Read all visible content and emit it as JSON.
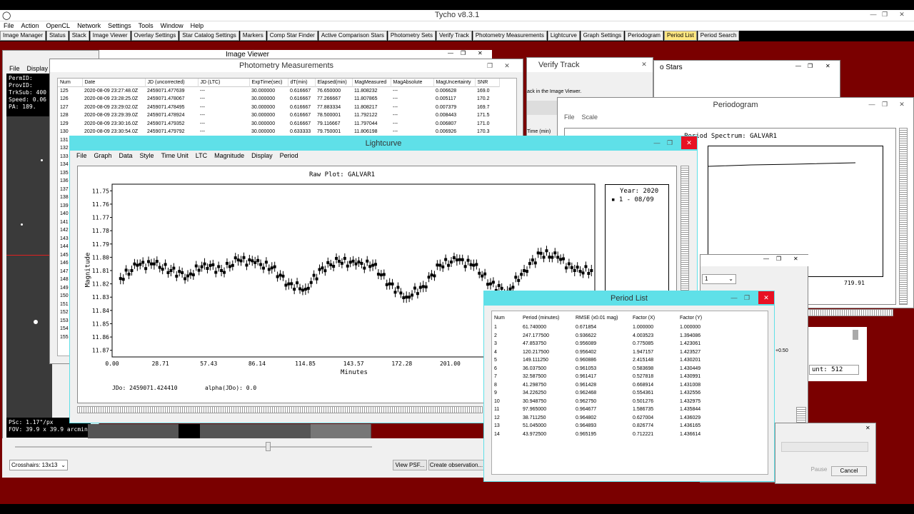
{
  "app": {
    "title": "Tycho v8.3.1",
    "menu": [
      "File",
      "Action",
      "OpenCL",
      "Network",
      "Settings",
      "Tools",
      "Window",
      "Help"
    ],
    "tabs": [
      "Image Manager",
      "Status",
      "Stack",
      "Image Viewer",
      "Overlay Settings",
      "Star Catalog Settings",
      "Markers",
      "Comp Star Finder",
      "Active Comparison Stars",
      "Photometry Sets",
      "Verify Track",
      "Photometry Measurements",
      "Lightcurve",
      "Graph Settings",
      "Periodogram",
      "Period List",
      "Period Search"
    ],
    "active_tab": "Period List"
  },
  "image_viewer": {
    "title": "Image Viewer",
    "menu": [
      "File",
      "Display"
    ],
    "info": [
      "PermID:",
      "ProvID:",
      "TrkSub: 400",
      "Speed: 0.06",
      "PA: 189."
    ],
    "footer": [
      "PSc: 1.17\"/px",
      "FOV: 39.9 x 39.9 arcmin"
    ],
    "crosshairs": "Crosshairs: 13x13",
    "view_psf": "View PSF...",
    "create_obs": "Create observation..."
  },
  "photometry": {
    "title": "Photometry Measurements",
    "columns": [
      "Num",
      "Date",
      "JD (uncorrected)",
      "JD (LTC)",
      "ExpTime(sec)",
      "dT(min)",
      "Elapsed(min)",
      "MagMeasured",
      "MagAbsolute",
      "MagUncertainty",
      "SNR"
    ],
    "rows": [
      [
        "125",
        "2020-08-09 23:27:48.0Z",
        "2459071.477639",
        "---",
        "30.000000",
        "0.616667",
        "76.650000",
        "11.808232",
        "---",
        "0.006628",
        "169.0"
      ],
      [
        "126",
        "2020-08-09 23:28:25.0Z",
        "2459071.478067",
        "---",
        "30.000000",
        "0.616667",
        "77.266667",
        "11.807865",
        "---",
        "0.005117",
        "170.2"
      ],
      [
        "127",
        "2020-08-09 23:29:02.0Z",
        "2459071.478495",
        "---",
        "30.000000",
        "0.616667",
        "77.883334",
        "11.808217",
        "---",
        "0.007379",
        "169.7"
      ],
      [
        "128",
        "2020-08-09 23:29:39.0Z",
        "2459071.478924",
        "---",
        "30.000000",
        "0.616667",
        "78.500001",
        "11.792122",
        "---",
        "0.008443",
        "171.5"
      ],
      [
        "129",
        "2020-08-09 23:30:16.0Z",
        "2459071.479352",
        "---",
        "30.000000",
        "0.616667",
        "79.116667",
        "11.797044",
        "---",
        "0.006807",
        "171.0"
      ],
      [
        "130",
        "2020-08-09 23:30:54.0Z",
        "2459071.479792",
        "---",
        "30.000000",
        "0.633333",
        "79.750001",
        "11.806198",
        "---",
        "0.006926",
        "170.3"
      ]
    ],
    "more_nums": [
      "131",
      "132",
      "133",
      "134",
      "135",
      "136",
      "137",
      "138",
      "139",
      "140",
      "141",
      "142",
      "143",
      "144",
      "145",
      "146",
      "147",
      "148",
      "149",
      "150",
      "151",
      "152",
      "153",
      "154",
      "155"
    ]
  },
  "verify": {
    "title": "Verify Track",
    "text": "ack in the Image Viewer.",
    "col": "Time (min)"
  },
  "stars": {
    "title": "o Stars"
  },
  "periodogram": {
    "title": "Periodogram",
    "menu": [
      "File",
      "Scale"
    ],
    "plot_title": "Period Spectrum: GALVAR1",
    "x_ticks": [
      "93",
      "719.91"
    ]
  },
  "side_panel": {
    "select": "1",
    "plus": "+0.50",
    "count": "unt:  512",
    "pause": "Pause",
    "cancel": "Cancel"
  },
  "lightcurve": {
    "title": "Lightcurve",
    "menu": [
      "File",
      "Graph",
      "Data",
      "Style",
      "Time Unit",
      "LTC",
      "Magnitude",
      "Display",
      "Period"
    ],
    "plot_title": "Raw Plot: GALVAR1",
    "xlabel": "Minutes",
    "ylabel": "Magnitude",
    "x_ticks": [
      "0.00",
      "28.71",
      "57.43",
      "86.14",
      "114.85",
      "143.57",
      "172.28",
      "201.00",
      "229.71",
      "258"
    ],
    "y_ticks": [
      "11.75",
      "11.76",
      "11.77",
      "11.78",
      "11.79",
      "11.80",
      "11.81",
      "11.82",
      "11.83",
      "11.84",
      "11.85",
      "11.86",
      "11.87"
    ],
    "legend_year": "Year: 2020",
    "legend_item": "1 - 08/09",
    "jd0": "JDo: 2459071.424410",
    "alpha": "alpha(JDo): 0.0"
  },
  "chart_data": {
    "type": "scatter",
    "title": "Raw Plot: GALVAR1",
    "xlabel": "Minutes",
    "ylabel": "Magnitude",
    "xlim": [
      0,
      287
    ],
    "ylim": [
      11.875,
      11.745
    ],
    "series": [
      {
        "name": "1 - 08/09",
        "x": [
          5,
          15,
          25,
          35,
          45,
          55,
          65,
          75,
          85,
          95,
          105,
          115,
          125,
          135,
          145,
          155,
          165,
          175,
          185,
          195,
          205,
          215,
          225,
          235,
          245,
          255,
          265,
          275,
          285
        ],
        "y": [
          11.816,
          11.806,
          11.805,
          11.81,
          11.814,
          11.805,
          11.81,
          11.802,
          11.804,
          11.808,
          11.82,
          11.824,
          11.808,
          11.803,
          11.805,
          11.806,
          11.82,
          11.83,
          11.822,
          11.806,
          11.802,
          11.806,
          11.82,
          11.826,
          11.81,
          11.797,
          11.8,
          11.81,
          11.81
        ]
      }
    ]
  },
  "period_list": {
    "title": "Period List",
    "columns": [
      "Num",
      "Period (minutes)",
      "RMSE (x0.01 mag)",
      "Factor (X)",
      "Factor (Y)"
    ],
    "rows": [
      [
        "1",
        "61.740000",
        "0.671854",
        "1.000000",
        "1.000000"
      ],
      [
        "2",
        "247.177500",
        "0.936622",
        "4.003523",
        "1.394086"
      ],
      [
        "3",
        "47.853750",
        "0.956089",
        "0.775085",
        "1.423061"
      ],
      [
        "4",
        "120.217500",
        "0.956402",
        "1.947157",
        "1.423527"
      ],
      [
        "5",
        "149.111250",
        "0.960886",
        "2.415148",
        "1.430201"
      ],
      [
        "6",
        "36.037500",
        "0.961053",
        "0.583698",
        "1.430449"
      ],
      [
        "7",
        "32.587500",
        "0.961417",
        "0.527818",
        "1.430991"
      ],
      [
        "8",
        "41.298750",
        "0.961428",
        "0.668914",
        "1.431008"
      ],
      [
        "9",
        "34.226250",
        "0.962468",
        "0.554361",
        "1.432556"
      ],
      [
        "10",
        "30.948750",
        "0.962750",
        "0.501276",
        "1.432975"
      ],
      [
        "11",
        "97.965000",
        "0.964677",
        "1.586735",
        "1.435844"
      ],
      [
        "12",
        "38.711250",
        "0.964802",
        "0.627004",
        "1.436029"
      ],
      [
        "13",
        "51.045000",
        "0.964893",
        "0.826774",
        "1.436165"
      ],
      [
        "14",
        "43.972500",
        "0.965195",
        "0.712221",
        "1.436614"
      ]
    ]
  }
}
